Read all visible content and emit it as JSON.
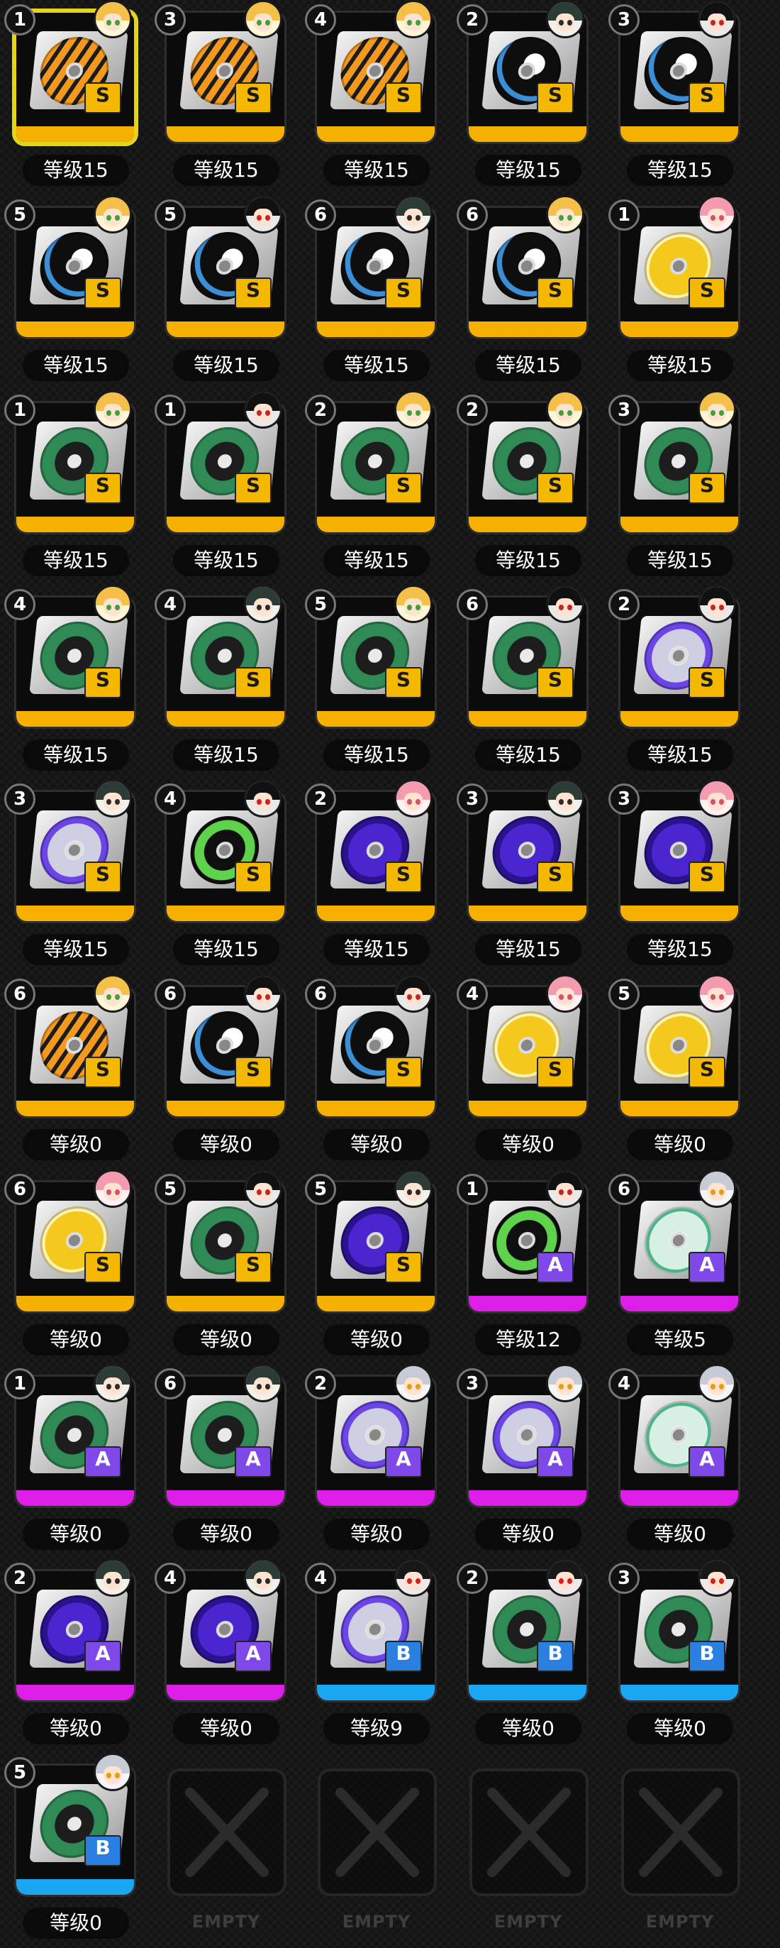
{
  "rarity_colors": {
    "S": "#f5b000",
    "A": "#dd1ee8",
    "B": "#1aa6f2"
  },
  "empty_label": "EMPTY",
  "slots": [
    {
      "num": "1",
      "level": "等级15",
      "rarity": "S",
      "disc": "tiger",
      "avatar": "blonde",
      "selected": true
    },
    {
      "num": "3",
      "level": "等级15",
      "rarity": "S",
      "disc": "tiger",
      "avatar": "blonde"
    },
    {
      "num": "4",
      "level": "等级15",
      "rarity": "S",
      "disc": "tiger",
      "avatar": "blonde"
    },
    {
      "num": "2",
      "level": "等级15",
      "rarity": "S",
      "disc": "shark",
      "avatar": "dark"
    },
    {
      "num": "3",
      "level": "等级15",
      "rarity": "S",
      "disc": "shark",
      "avatar": "black"
    },
    {
      "num": "5",
      "level": "等级15",
      "rarity": "S",
      "disc": "shark",
      "avatar": "blonde"
    },
    {
      "num": "5",
      "level": "等级15",
      "rarity": "S",
      "disc": "shark",
      "avatar": "black"
    },
    {
      "num": "6",
      "level": "等级15",
      "rarity": "S",
      "disc": "shark",
      "avatar": "dark"
    },
    {
      "num": "6",
      "level": "等级15",
      "rarity": "S",
      "disc": "shark",
      "avatar": "blonde"
    },
    {
      "num": "1",
      "level": "等级15",
      "rarity": "S",
      "disc": "flame",
      "avatar": "pink"
    },
    {
      "num": "1",
      "level": "等级15",
      "rarity": "S",
      "disc": "green",
      "avatar": "blonde"
    },
    {
      "num": "1",
      "level": "等级15",
      "rarity": "S",
      "disc": "green",
      "avatar": "black"
    },
    {
      "num": "2",
      "level": "等级15",
      "rarity": "S",
      "disc": "green",
      "avatar": "blonde"
    },
    {
      "num": "2",
      "level": "等级15",
      "rarity": "S",
      "disc": "green",
      "avatar": "blonde"
    },
    {
      "num": "3",
      "level": "等级15",
      "rarity": "S",
      "disc": "green",
      "avatar": "blonde"
    },
    {
      "num": "4",
      "level": "等级15",
      "rarity": "S",
      "disc": "green",
      "avatar": "blonde"
    },
    {
      "num": "4",
      "level": "等级15",
      "rarity": "S",
      "disc": "green",
      "avatar": "dark"
    },
    {
      "num": "5",
      "level": "等级15",
      "rarity": "S",
      "disc": "green",
      "avatar": "blonde"
    },
    {
      "num": "6",
      "level": "等级15",
      "rarity": "S",
      "disc": "green",
      "avatar": "black"
    },
    {
      "num": "2",
      "level": "等级15",
      "rarity": "S",
      "disc": "purple-light",
      "avatar": "black"
    },
    {
      "num": "3",
      "level": "等级15",
      "rarity": "S",
      "disc": "purple-light",
      "avatar": "dark"
    },
    {
      "num": "4",
      "level": "等级15",
      "rarity": "S",
      "disc": "lime",
      "avatar": "black"
    },
    {
      "num": "2",
      "level": "等级15",
      "rarity": "S",
      "disc": "purple",
      "avatar": "pink"
    },
    {
      "num": "3",
      "level": "等级15",
      "rarity": "S",
      "disc": "purple",
      "avatar": "dark"
    },
    {
      "num": "3",
      "level": "等级15",
      "rarity": "S",
      "disc": "purple",
      "avatar": "pink"
    },
    {
      "num": "6",
      "level": "等级0",
      "rarity": "S",
      "disc": "tiger",
      "avatar": "blonde"
    },
    {
      "num": "6",
      "level": "等级0",
      "rarity": "S",
      "disc": "shark",
      "avatar": "black"
    },
    {
      "num": "6",
      "level": "等级0",
      "rarity": "S",
      "disc": "shark",
      "avatar": "black"
    },
    {
      "num": "4",
      "level": "等级0",
      "rarity": "S",
      "disc": "flame",
      "avatar": "pink"
    },
    {
      "num": "5",
      "level": "等级0",
      "rarity": "S",
      "disc": "flame",
      "avatar": "pink"
    },
    {
      "num": "6",
      "level": "等级0",
      "rarity": "S",
      "disc": "flame",
      "avatar": "pink"
    },
    {
      "num": "5",
      "level": "等级0",
      "rarity": "S",
      "disc": "green",
      "avatar": "black"
    },
    {
      "num": "5",
      "level": "等级0",
      "rarity": "S",
      "disc": "purple",
      "avatar": "dark"
    },
    {
      "num": "1",
      "level": "等级12",
      "rarity": "A",
      "disc": "lime",
      "avatar": "black"
    },
    {
      "num": "6",
      "level": "等级5",
      "rarity": "A",
      "disc": "mint",
      "avatar": "silver"
    },
    {
      "num": "1",
      "level": "等级0",
      "rarity": "A",
      "disc": "green",
      "avatar": "dark"
    },
    {
      "num": "6",
      "level": "等级0",
      "rarity": "A",
      "disc": "green",
      "avatar": "dark"
    },
    {
      "num": "2",
      "level": "等级0",
      "rarity": "A",
      "disc": "purple-light",
      "avatar": "silver"
    },
    {
      "num": "3",
      "level": "等级0",
      "rarity": "A",
      "disc": "purple-light",
      "avatar": "silver"
    },
    {
      "num": "4",
      "level": "等级0",
      "rarity": "A",
      "disc": "mint",
      "avatar": "silver"
    },
    {
      "num": "2",
      "level": "等级0",
      "rarity": "A",
      "disc": "purple",
      "avatar": "dark"
    },
    {
      "num": "4",
      "level": "等级0",
      "rarity": "A",
      "disc": "purple",
      "avatar": "dark"
    },
    {
      "num": "4",
      "level": "等级9",
      "rarity": "B",
      "disc": "purple-light",
      "avatar": "red"
    },
    {
      "num": "2",
      "level": "等级0",
      "rarity": "B",
      "disc": "green",
      "avatar": "red"
    },
    {
      "num": "3",
      "level": "等级0",
      "rarity": "B",
      "disc": "green",
      "avatar": "red"
    },
    {
      "num": "5",
      "level": "等级0",
      "rarity": "B",
      "disc": "green",
      "avatar": "silver"
    },
    {
      "empty": true
    },
    {
      "empty": true
    },
    {
      "empty": true
    },
    {
      "empty": true
    }
  ]
}
